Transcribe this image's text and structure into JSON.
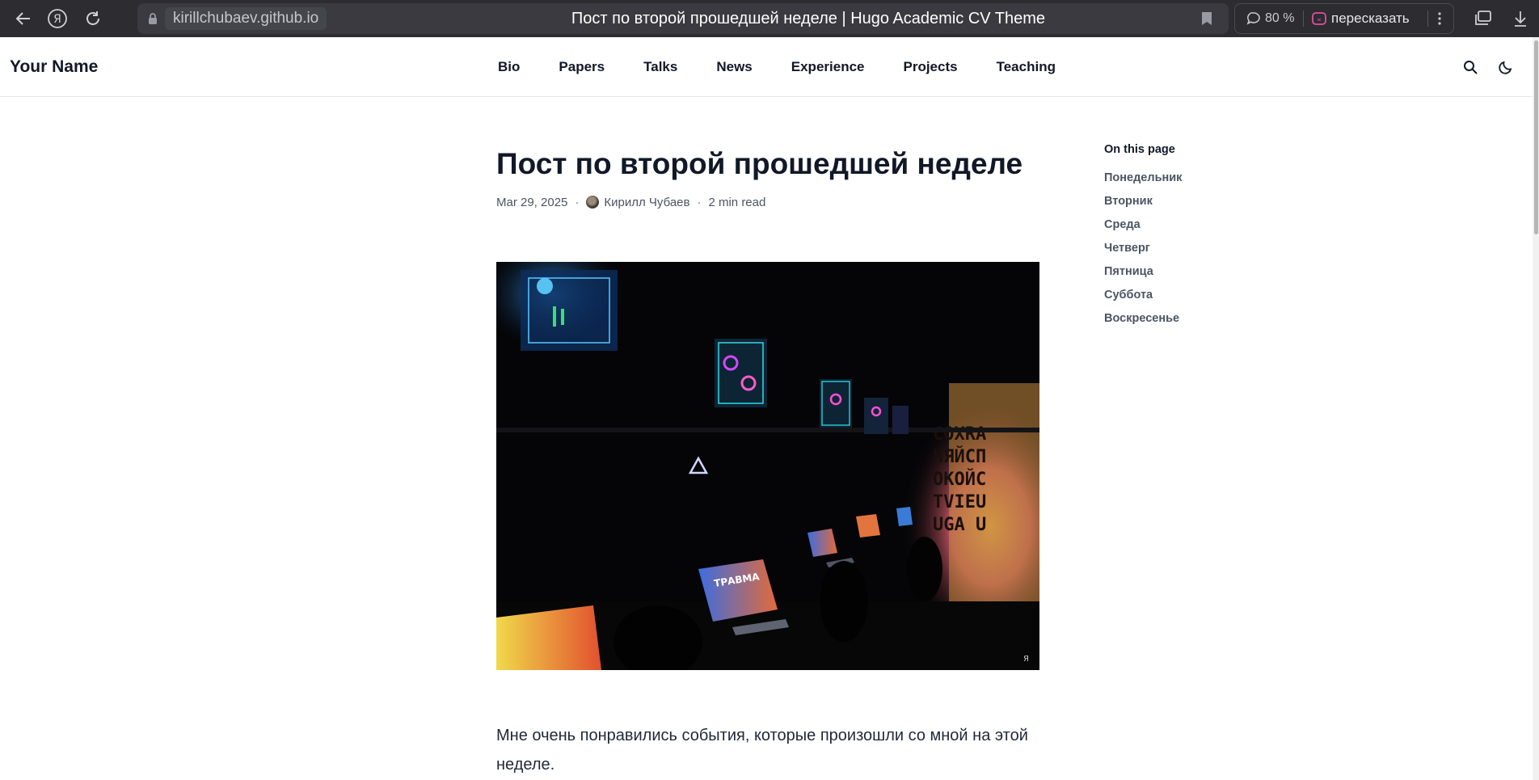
{
  "browser": {
    "domain": "kirillchubaev.github.io",
    "tab_title": "Пост по второй прошедшей неделе | Hugo Academic CV Theme",
    "zoom": "80 %",
    "retell_label": "пересказать",
    "yandex_glyph": "Я"
  },
  "header": {
    "brand": "Your Name",
    "nav": [
      "Bio",
      "Papers",
      "Talks",
      "News",
      "Experience",
      "Projects",
      "Teaching"
    ]
  },
  "post": {
    "title": "Пост по второй прошедшей неделе",
    "date": "Mar 29, 2025",
    "author": "Кирилл Чубаев",
    "read_time": "2 min read",
    "image_wall_lines": [
      "COXRA",
      "НЯЙСП",
      "OKOЙC",
      "TVIEU",
      "UGA U"
    ],
    "image_screen_label": "ТРАВМА",
    "image_watermark": "Я",
    "body": "Мне очень понравились события, которые произошли со мной на этой неделе."
  },
  "toc": {
    "title": "On this page",
    "items": [
      "Понедельник",
      "Вторник",
      "Среда",
      "Четверг",
      "Пятница",
      "Суббота",
      "Воскресенье"
    ]
  },
  "icons": {
    "back": "back-arrow-icon",
    "yandex": "yandex-logo-icon",
    "reload": "reload-icon",
    "lock": "lock-icon",
    "bookmark": "bookmark-icon",
    "comment": "comment-icon",
    "retell": "retell-icon",
    "more": "kebab-menu-icon",
    "tabs": "tabs-icon",
    "download": "download-icon",
    "search": "search-icon",
    "theme": "moon-icon"
  }
}
